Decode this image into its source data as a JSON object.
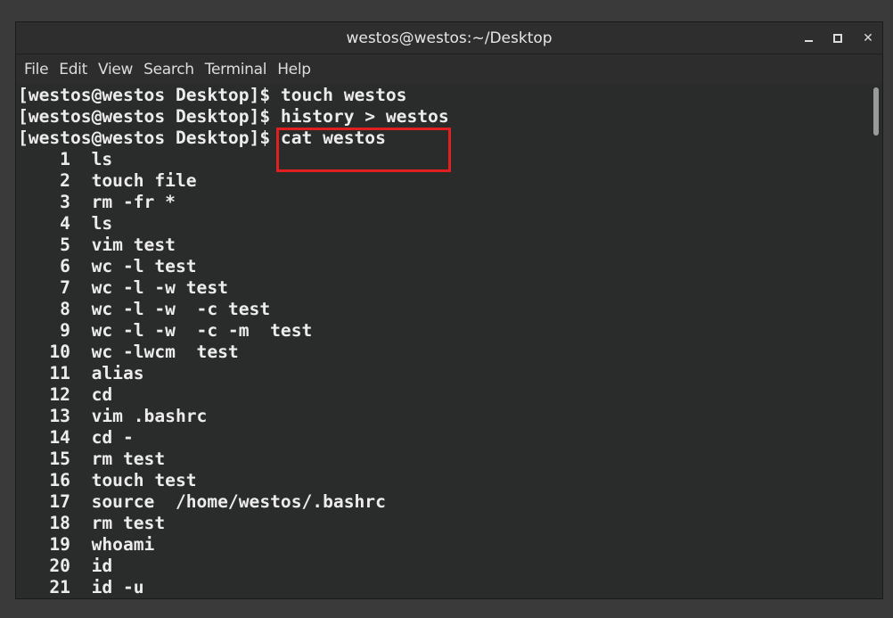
{
  "window": {
    "title": "westos@westos:~/Desktop"
  },
  "menu": [
    "File",
    "Edit",
    "View",
    "Search",
    "Terminal",
    "Help"
  ],
  "terminal": {
    "lines": [
      "[westos@westos Desktop]$ touch westos",
      "[westos@westos Desktop]$ history > westos",
      "[westos@westos Desktop]$ cat westos",
      "    1  ls",
      "    2  touch file",
      "    3  rm -fr *",
      "    4  ls",
      "    5  vim test",
      "    6  wc -l test",
      "    7  wc -l -w test",
      "    8  wc -l -w  -c test",
      "    9  wc -l -w  -c -m  test",
      "   10  wc -lwcm  test",
      "   11  alias",
      "   12  cd",
      "   13  vim .bashrc",
      "   14  cd -",
      "   15  rm test",
      "   16  touch test",
      "   17  source  /home/westos/.bashrc",
      "   18  rm test",
      "   19  whoami",
      "   20  id",
      "   21  id -u"
    ]
  },
  "colors": {
    "highlight": "#e02020",
    "terminal_bg": "#2a2c2b",
    "text": "#ececec"
  }
}
